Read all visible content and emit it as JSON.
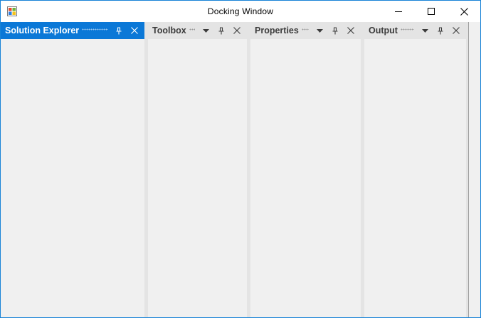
{
  "window": {
    "title": "Docking Window",
    "caption_buttons": [
      "minimize-icon",
      "maximize-icon",
      "close-icon"
    ],
    "app_icon": "windows-app-icon"
  },
  "panes": [
    {
      "title": "Solution Explorer",
      "active": true,
      "buttons": [
        "pin-icon",
        "close-icon"
      ]
    },
    {
      "title": "Toolbox",
      "active": false,
      "buttons": [
        "dropdown-arrow-icon",
        "pin-icon",
        "close-icon"
      ]
    },
    {
      "title": "Properties",
      "active": false,
      "buttons": [
        "dropdown-arrow-icon",
        "pin-icon",
        "close-icon"
      ]
    },
    {
      "title": "Output",
      "active": false,
      "buttons": [
        "dropdown-arrow-icon",
        "pin-icon",
        "close-icon"
      ]
    }
  ],
  "colors": {
    "active_header": "#0b78d7",
    "inactive_header": "#e4e4e4",
    "window_border": "#1883d7",
    "client_background": "#f0f0f0"
  }
}
